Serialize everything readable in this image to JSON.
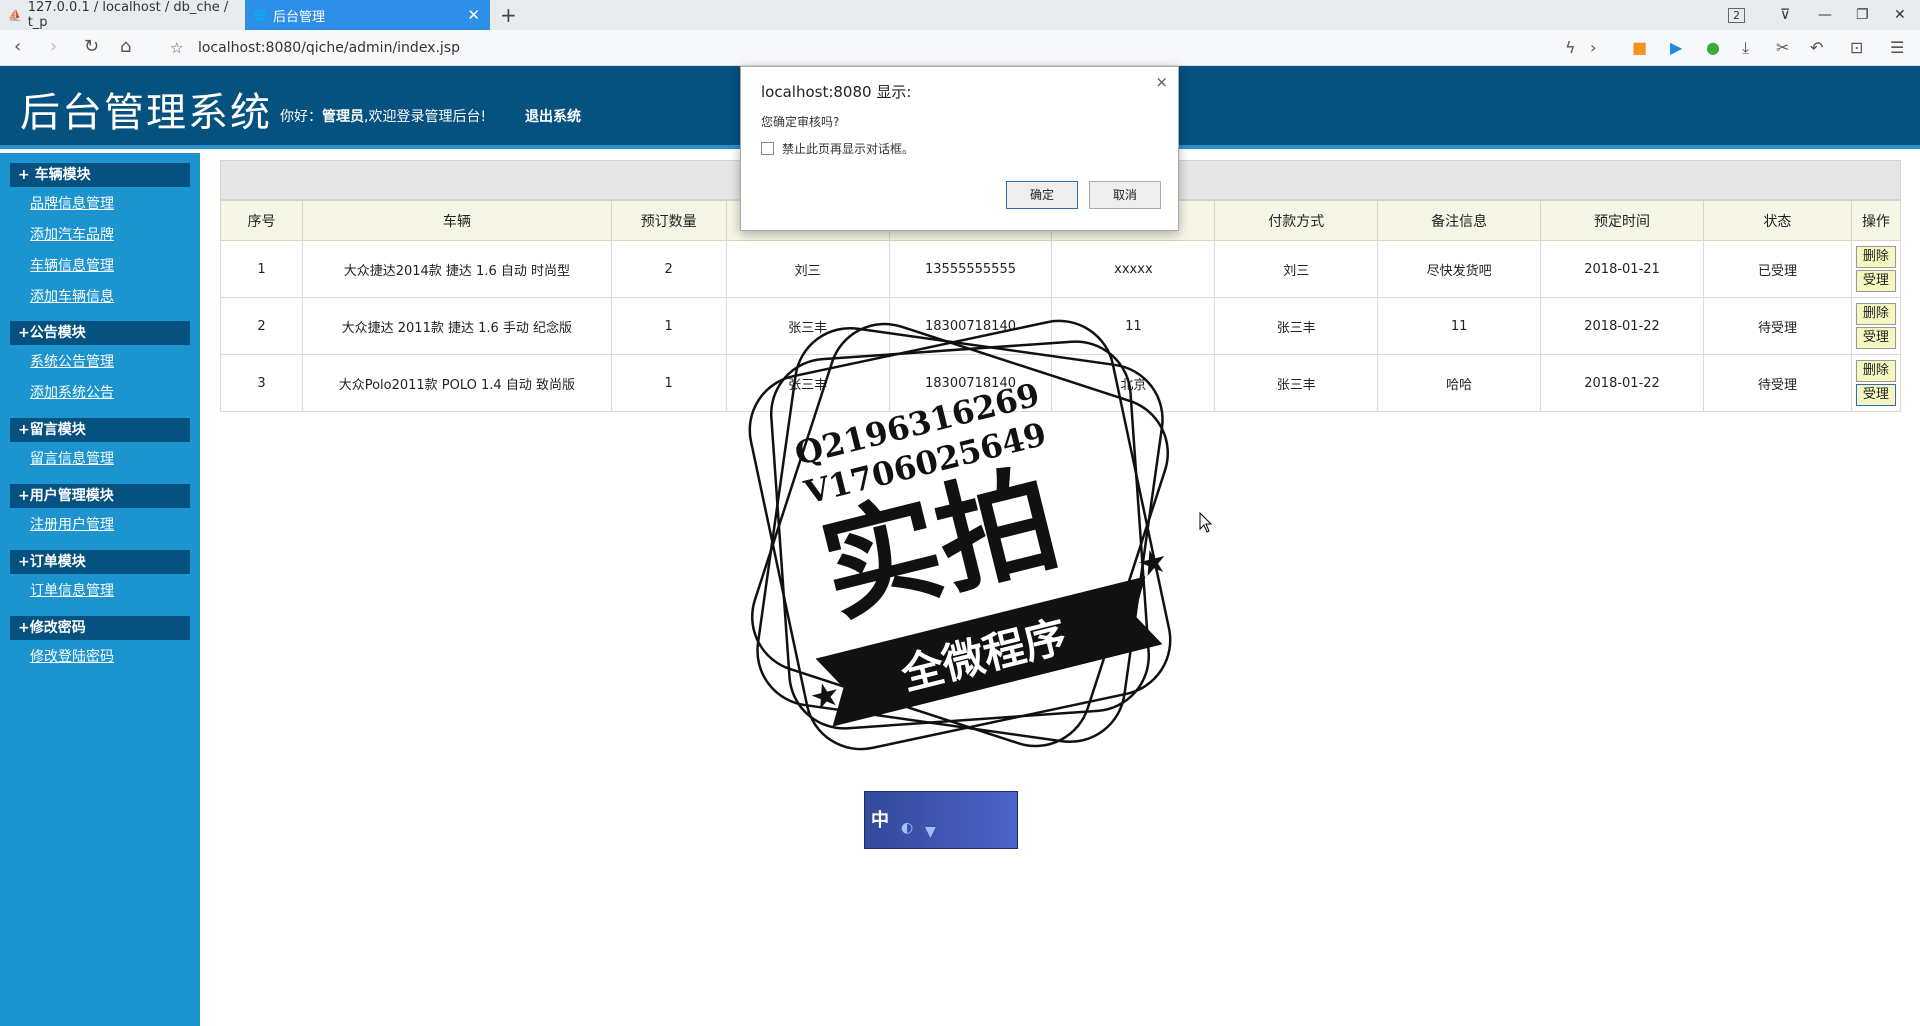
{
  "browser": {
    "tab1_title": "127.0.0.1 / localhost / db_che / t_p",
    "tab2_title": "后台管理",
    "tab_count": "2",
    "url": "localhost:8080/qiche/admin/index.jsp"
  },
  "header": {
    "title": "后台管理系统",
    "greeting_prefix": "你好：",
    "user": "管理员",
    "greeting_suffix": ",欢迎登录管理后台!",
    "logout": "退出系统"
  },
  "sidebar": {
    "modules": [
      {
        "title": "+ 车辆模块",
        "links": [
          "品牌信息管理",
          "添加汽车品牌",
          "车辆信息管理",
          "添加车辆信息"
        ]
      },
      {
        "title": "+公告模块",
        "links": [
          "系统公告管理",
          "添加系统公告"
        ]
      },
      {
        "title": "+留言模块",
        "links": [
          "留言信息管理"
        ]
      },
      {
        "title": "+用户管理模块",
        "links": [
          "注册用户管理"
        ]
      },
      {
        "title": "+订单模块",
        "links": [
          "订单信息管理"
        ]
      },
      {
        "title": "+修改密码",
        "links": [
          "修改登陆密码"
        ]
      }
    ]
  },
  "table": {
    "headers": [
      "序号",
      "车辆",
      "预订数量",
      "",
      "",
      "",
      "付款方式",
      "备注信息",
      "预定时间",
      "状态",
      "操作"
    ],
    "rows": [
      [
        "1",
        "大众捷达2014款 捷达 1.6 自动 时尚型",
        "2",
        "刘三",
        "13555555555",
        "xxxxx",
        "刘三",
        "尽快发货吧",
        "2018-01-21",
        "已受理"
      ],
      [
        "2",
        "大众捷达 2011款 捷达 1.6 手动 纪念版",
        "1",
        "张三丰",
        "18300718140",
        "11",
        "张三丰",
        "11",
        "2018-01-22",
        "待受理"
      ],
      [
        "3",
        "大众Polo2011款 POLO 1.4 自动 致尚版",
        "1",
        "张三丰",
        "18300718140",
        "北京",
        "张三丰",
        "哈哈",
        "2018-01-22",
        "待受理"
      ]
    ],
    "delete_label": "删除",
    "accept_label": "受理"
  },
  "dialog": {
    "title": "localhost:8080 显示:",
    "message": "您确定审核吗?",
    "checkbox_label": "禁止此页再显示对话框。",
    "ok_label": "确定",
    "cancel_label": "取消"
  },
  "watermark": {
    "qq": "Q2196316269",
    "wx": "V1706025649",
    "big": "实拍",
    "ribbon": "全微程序"
  },
  "badge": {
    "text": "中"
  }
}
